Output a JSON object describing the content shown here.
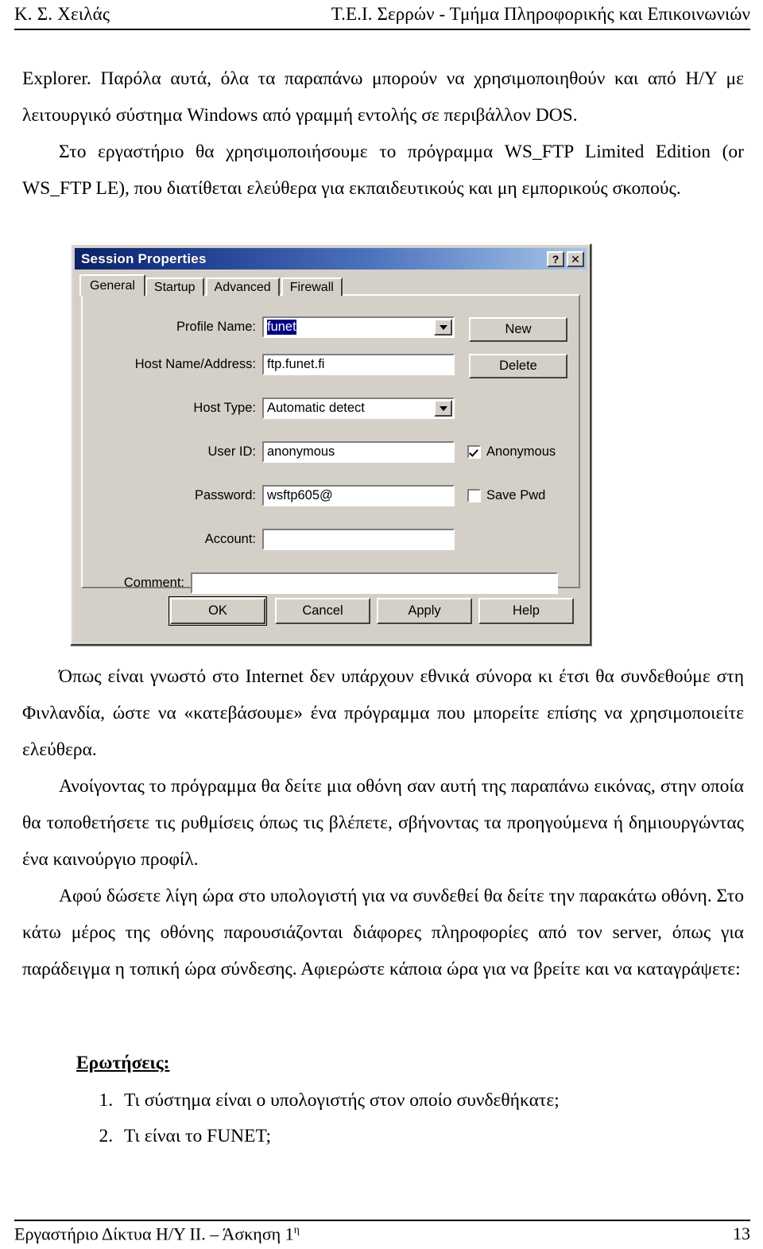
{
  "header": {
    "left": "Κ. Σ. Χειλάς",
    "right": "Τ.Ε.Ι. Σερρών - Τμήμα Πληροφορικής και Επικοινωνιών"
  },
  "body": {
    "para1": "Explorer. Παρόλα αυτά, όλα τα παραπάνω μπορούν να χρησιμοποιηθούν και από Η/Υ με λειτουργικό σύστημα Windows από γραμμή εντολής σε περιβάλλον DOS.",
    "para2": "Στο εργαστήριο θα χρησιμοποιήσουμε το πρόγραμμα WS_FTP Limited Edition (or WS_FTP LE), που διατίθεται ελεύθερα για εκπαιδευτικούς και μη εμπορικούς σκοπούς.",
    "para3": "Όπως είναι γνωστό στο Internet δεν υπάρχουν εθνικά σύνορα κι έτσι θα συνδεθούμε στη Φινλανδία, ώστε να «κατεβάσουμε» ένα πρόγραμμα που μπορείτε επίσης να χρησιμοποιείτε ελεύθερα.",
    "para4": "Ανοίγοντας το πρόγραμμα θα δείτε μια οθόνη σαν αυτή της παραπάνω εικόνας, στην οποία θα τοποθετήσετε τις ρυθμίσεις όπως τις βλέπετε, σβήνοντας τα προηγούμενα ή δημιουργώντας ένα καινούργιο προφίλ.",
    "para5": "Αφού δώσετε λίγη ώρα στο υπολογιστή για να συνδεθεί θα δείτε την παρακάτω οθόνη. Στο κάτω μέρος της οθόνης παρουσιάζονται διάφορες πληροφορίες από τον server, όπως για παράδειγμα η τοπική ώρα σύνδεσης. Αφιερώστε κάποια ώρα για να βρείτε και να καταγράψετε:"
  },
  "dialog": {
    "title": "Session Properties",
    "help_button": "?",
    "close_button": "✕",
    "tabs": [
      {
        "label": "General",
        "active": true
      },
      {
        "label": "Startup",
        "active": false
      },
      {
        "label": "Advanced",
        "active": false
      },
      {
        "label": "Firewall",
        "active": false
      }
    ],
    "fields": {
      "profile_name": {
        "label": "Profile Name:",
        "value": "funet",
        "selected": true
      },
      "host_name": {
        "label": "Host Name/Address:",
        "value": "ftp.funet.fi"
      },
      "host_type": {
        "label": "Host Type:",
        "value": "Automatic detect"
      },
      "user_id": {
        "label": "User ID:",
        "value": "anonymous"
      },
      "password": {
        "label": "Password:",
        "value": "wsftp605@"
      },
      "account": {
        "label": "Account:",
        "value": ""
      },
      "comment": {
        "label": "Comment:",
        "value": ""
      }
    },
    "checkboxes": {
      "anonymous": {
        "label": "Anonymous",
        "checked": true
      },
      "save_pwd": {
        "label": "Save Pwd",
        "checked": false
      }
    },
    "side_buttons": {
      "new": "New",
      "delete": "Delete"
    },
    "action_buttons": {
      "ok": "OK",
      "cancel": "Cancel",
      "apply": "Apply",
      "help": "Help"
    },
    "colors": {
      "face": "#d4d0c8",
      "titlebar_start": "#0b2268",
      "titlebar_end": "#a9c4e8",
      "selection": "#000080"
    }
  },
  "questions": {
    "heading": "Ερωτήσεις:",
    "items": [
      "Τι σύστημα είναι ο υπολογιστής στον οποίο συνδεθήκατε;",
      "Τι είναι το FUNET;"
    ]
  },
  "footer": {
    "left_prefix": "Εργαστήριο Δίκτυα Η/Υ ΙΙ. – Άσκηση 1",
    "left_sup": "η",
    "page_number": "13"
  }
}
